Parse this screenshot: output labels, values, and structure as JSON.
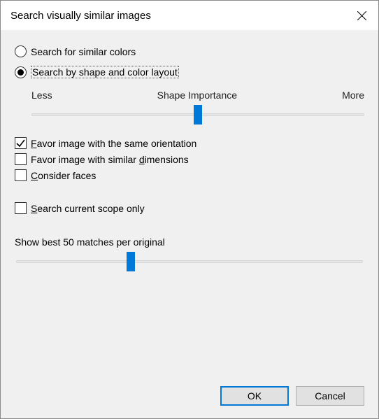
{
  "title": "Search visually similar images",
  "radios": {
    "similar_colors": "Search for similar colors",
    "shape_color_layout": "Search by shape and color layout",
    "selected": "shape_color_layout"
  },
  "slider_importance": {
    "left_label": "Less",
    "center_label": "Shape Importance",
    "right_label": "More",
    "value_percent": 50
  },
  "checkboxes": {
    "favor_orientation": {
      "label": "Favor image with the same orientation",
      "checked": true
    },
    "favor_dimensions": {
      "label": "Favor image with similar dimensions",
      "checked": false
    },
    "consider_faces": {
      "label": "Consider faces",
      "checked": false
    },
    "current_scope": {
      "label": "Search current scope only",
      "checked": false
    }
  },
  "matches_text": "Show best 50 matches per original",
  "slider_matches": {
    "value_percent": 33
  },
  "buttons": {
    "ok": "OK",
    "cancel": "Cancel"
  }
}
